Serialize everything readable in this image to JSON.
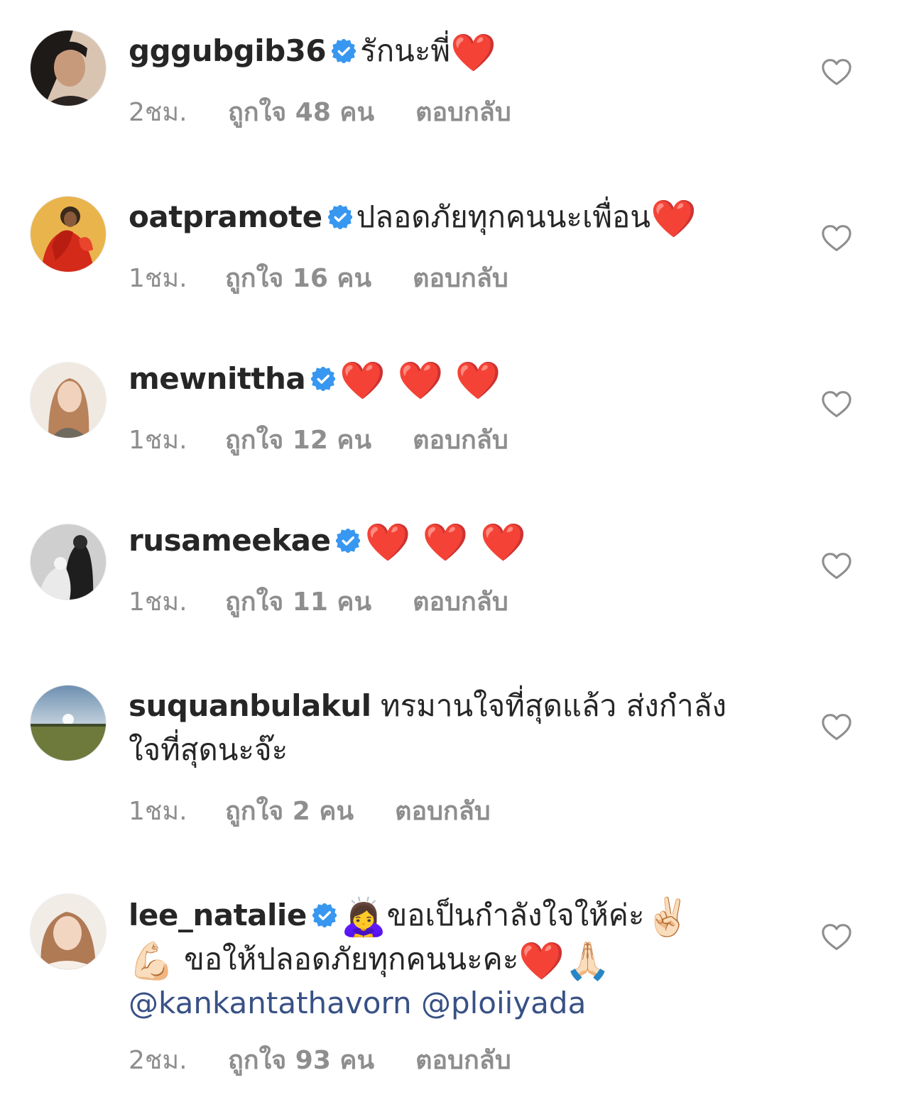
{
  "comments": [
    {
      "username": "gggubgib36",
      "verified": true,
      "text": "รักนะพี่",
      "emojis": "❤️",
      "time": "2ชม.",
      "likes": "ถูกใจ 48 คน",
      "reply": "ตอบกลับ",
      "avatar_icon": "avatar-portrait-woman"
    },
    {
      "username": "oatpramote",
      "verified": true,
      "text": "ปลอดภัยทุกคนนะเพื่อน",
      "emojis": "❤️",
      "time": "1ชม.",
      "likes": "ถูกใจ 16 คน",
      "reply": "ตอบกลับ",
      "avatar_icon": "avatar-art-red-figure"
    },
    {
      "username": "mewnittha",
      "verified": true,
      "text": "",
      "emojis": "❤️ ❤️ ❤️",
      "time": "1ชม.",
      "likes": "ถูกใจ 12 คน",
      "reply": "ตอบกลับ",
      "avatar_icon": "avatar-portrait-woman"
    },
    {
      "username": "rusameekae",
      "verified": true,
      "text": "",
      "emojis": "❤️ ❤️ ❤️",
      "time": "1ชม.",
      "likes": "ถูกใจ 11 คน",
      "reply": "ตอบกลับ",
      "avatar_icon": "avatar-bw-couple"
    },
    {
      "username": "suquanbulakul",
      "verified": false,
      "text_line1": "ทรมานใจที่สุดแล้ว ส่งกำลัง",
      "text_line2": "ใจที่สุดนะจ๊ะ",
      "time": "1ชม.",
      "likes": "ถูกใจ 2 คน",
      "reply": "ตอบกลับ",
      "avatar_icon": "avatar-landscape-field"
    },
    {
      "username": "lee_natalie",
      "verified": true,
      "emoji_lead": "🙇‍♀️",
      "text_line1": "ขอเป็นกำลังใจให้ค่ะ",
      "emoji_line1_end": "✌🏻",
      "emoji_line2_start": "💪🏻",
      "text_line2": "ขอให้ปลอดภัยทุกคนนะคะ",
      "emoji_line2_end": "❤️🙏🏻",
      "mentions": "@kankantathavorn @ploiiyada",
      "time": "2ชม.",
      "likes": "ถูกใจ 93 คน",
      "reply": "ตอบกลับ",
      "avatar_icon": "avatar-portrait-woman"
    }
  ],
  "colors": {
    "text": "#262626",
    "meta": "#8e8e8e",
    "verified_badge": "#3897f0",
    "mention": "#385185",
    "heart_outline": "#8e8e8e"
  }
}
